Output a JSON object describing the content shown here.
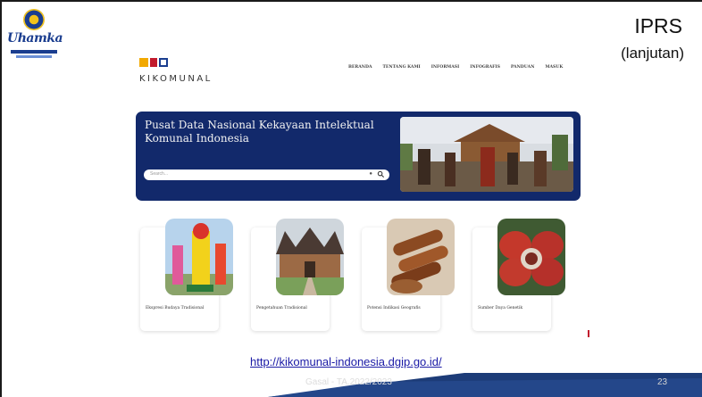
{
  "slide": {
    "title": "IPRS",
    "subtitle": "(lanjutan)",
    "link": "http://kikomunal-indonesia.dgip.go.id/",
    "footer": "Gasal - TA.2022/2023",
    "page_number": "23"
  },
  "university_logo": {
    "wordmark": "Uhamka"
  },
  "website": {
    "logo_name": "KIKOMUNAL",
    "nav": [
      "BERANDA",
      "TENTANG KAMI",
      "INFORMASI",
      "INFOGRAFIS",
      "PANDUAN",
      "MASUK"
    ],
    "hero": {
      "title": "Pusat Data Nasional Kekayaan Intelektual Komunal Indonesia",
      "search_placeholder": "Search..."
    },
    "cards": [
      {
        "label": "Ekspresi Budaya Tradisional"
      },
      {
        "label": "Pengetahuan Tradisional"
      },
      {
        "label": "Potensi Indikasi Geografis"
      },
      {
        "label": "Sumber Daya Genetik"
      }
    ]
  },
  "colors": {
    "hero_bg": "#12296b",
    "footer_band": "#1d3c78",
    "link": "#1a1aa6"
  }
}
